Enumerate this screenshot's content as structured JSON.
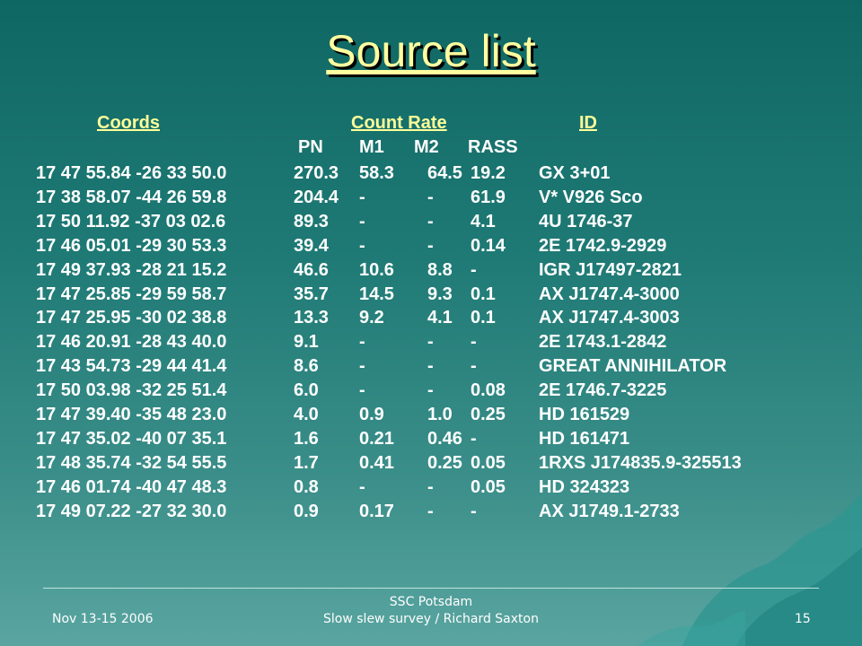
{
  "title": "Source list",
  "headers": {
    "coords": "Coords ",
    "count_rate": "Count Rate",
    "id": "ID"
  },
  "subheaders": {
    "pn": "PN",
    "m1": "M1",
    "m2": "M2",
    "rass": "RASS"
  },
  "rows": [
    {
      "coords": "17 47 55.84 -26 33 50.0",
      "pn": "270.3",
      "m1": "58.3",
      "m2": "64.5",
      "rass": "19.2",
      "id": "GX 3+01"
    },
    {
      "coords": "17 38 58.07 -44 26 59.8",
      "pn": "204.4",
      "m1": "-",
      "m2": "-",
      "rass": "61.9",
      "id": "V* V926 Sco"
    },
    {
      "coords": "17 50 11.92 -37 03 02.6",
      "pn": "89.3",
      "m1": "-",
      "m2": "-",
      "rass": "4.1",
      "id": "4U 1746-37"
    },
    {
      "coords": "17 46 05.01 -29 30 53.3",
      "pn": "39.4",
      "m1": "-",
      "m2": "-",
      "rass": "0.14",
      "id": "2E 1742.9-2929"
    },
    {
      "coords": "17 49 37.93 -28 21 15.2",
      "pn": "46.6",
      "m1": "10.6",
      "m2": "8.8",
      "rass": "-",
      "id": "IGR J17497-2821"
    },
    {
      "coords": "17 47 25.85 -29 59 58.7",
      "pn": "35.7",
      "m1": "14.5",
      "m2": "9.3",
      "rass": "0.1",
      "id": "AX J1747.4-3000"
    },
    {
      "coords": "17 47 25.95 -30 02 38.8",
      "pn": "13.3",
      "m1": "9.2",
      "m2": "4.1",
      "rass": "0.1",
      "id": "AX J1747.4-3003"
    },
    {
      "coords": "17 46 20.91 -28 43 40.0",
      "pn": "9.1",
      "m1": "-",
      "m2": "-",
      "rass": "-",
      "id": "2E 1743.1-2842"
    },
    {
      "coords": "17 43 54.73 -29 44 41.4",
      "pn": "8.6",
      "m1": "-",
      "m2": "-",
      "rass": "-",
      "id": "GREAT ANNIHILATOR"
    },
    {
      "coords": "17 50 03.98 -32 25 51.4",
      "pn": "6.0",
      "m1": "-",
      "m2": "-",
      "rass": "0.08",
      "id": "2E 1746.7-3225"
    },
    {
      "coords": "17 47 39.40 -35 48 23.0",
      "pn": "4.0",
      "m1": "0.9",
      "m2": "1.0",
      "rass": "0.25",
      "id": "HD 161529"
    },
    {
      "coords": "17 47 35.02 -40 07 35.1",
      "pn": "1.6",
      "m1": "0.21",
      "m2": "0.46",
      "rass": "-",
      "id": "HD 161471"
    },
    {
      "coords": "17 48 35.74 -32 54 55.5",
      "pn": "1.7",
      "m1": "0.41",
      "m2": "0.25",
      "rass": "0.05",
      "id": "1RXS J174835.9-325513"
    },
    {
      "coords": "17 46 01.74 -40 47 48.3",
      "pn": "0.8",
      "m1": "-",
      "m2": "-",
      "rass": "0.05",
      "id": "HD 324323"
    },
    {
      "coords": "17 49 07.22 -27 32 30.0",
      "pn": "0.9",
      "m1": "0.17",
      "m2": "-",
      "rass": "-",
      "id": "AX J1749.1-2733"
    }
  ],
  "footer": {
    "date": "Nov 13-15 2006",
    "center_line1": "SSC Potsdam",
    "center_line2": "Slow slew survey / Richard Saxton",
    "page": "15"
  }
}
